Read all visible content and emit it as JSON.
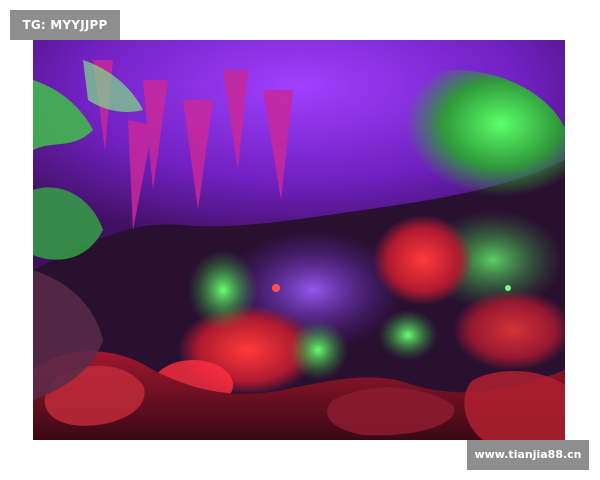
{
  "watermarks": {
    "top_left": "TG: MYYJJPP",
    "bottom_right": "www.tianjia88.cn"
  },
  "photo": {
    "subject": "cave-interior-colored-lights",
    "colors": {
      "purple": "#8a2be2",
      "magenta": "#c0208a",
      "green": "#3fbf4a",
      "red": "#d8202a",
      "dark": "#2a1030"
    }
  }
}
